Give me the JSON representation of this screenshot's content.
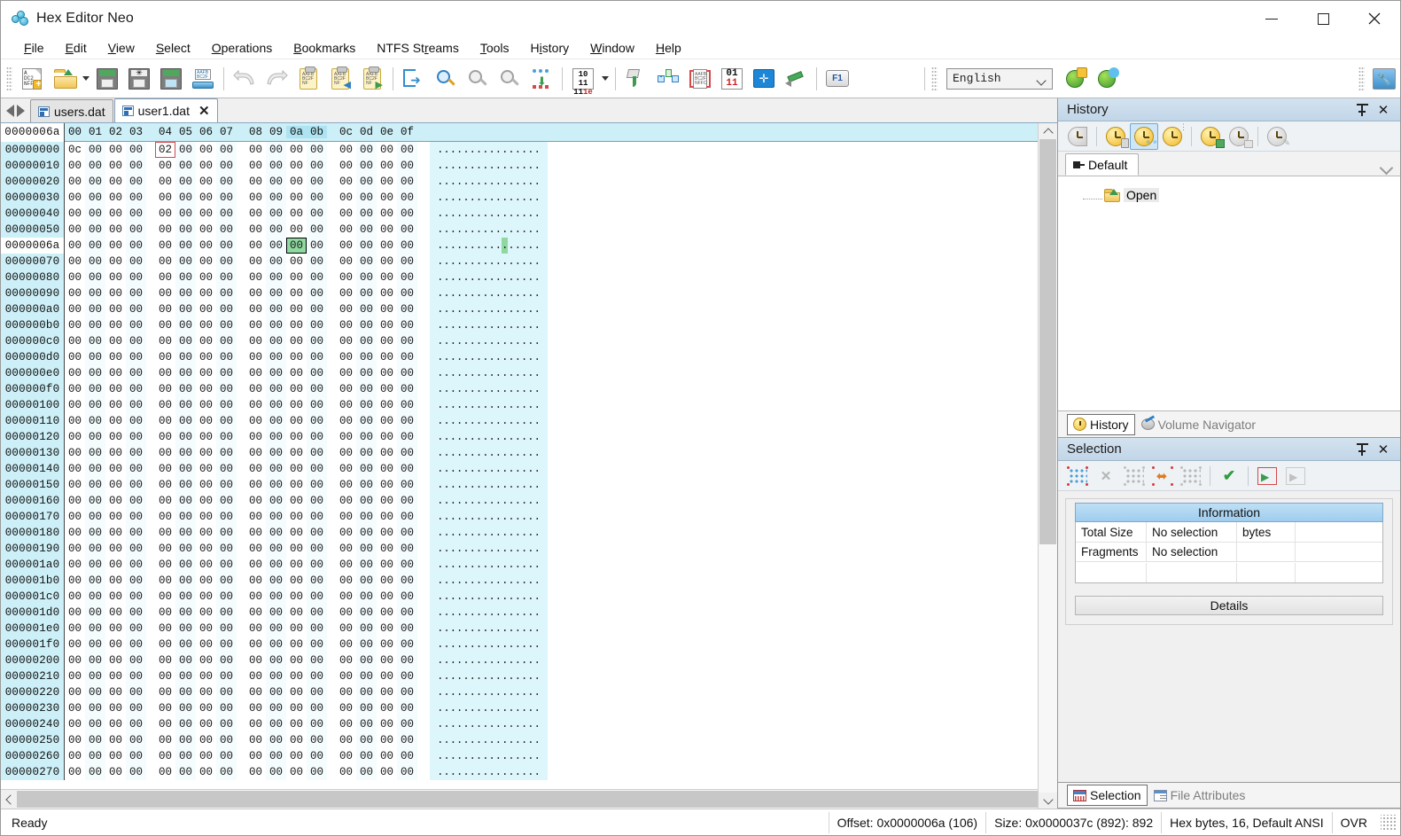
{
  "window": {
    "title": "Hex Editor Neo",
    "app_icon": "hexeditor-logo-icon",
    "minimize": "–",
    "maximize": "□",
    "close": "✕"
  },
  "menubar": {
    "items": [
      {
        "label": "File",
        "accel": "F"
      },
      {
        "label": "Edit",
        "accel": "E"
      },
      {
        "label": "View",
        "accel": "V"
      },
      {
        "label": "Select",
        "accel": "S"
      },
      {
        "label": "Operations",
        "accel": "O"
      },
      {
        "label": "Bookmarks",
        "accel": "B"
      },
      {
        "label": "NTFS Streams",
        "accel": "r"
      },
      {
        "label": "Tools",
        "accel": "T"
      },
      {
        "label": "History",
        "accel": "i"
      },
      {
        "label": "Window",
        "accel": "W"
      },
      {
        "label": "Help",
        "accel": "H"
      }
    ]
  },
  "toolbar": {
    "buttons": [
      {
        "name": "new-file-icon",
        "tip": "New"
      },
      {
        "name": "open-file-icon",
        "tip": "Open"
      },
      {
        "name": "open-dropdown-caret",
        "tip": "Open recent"
      },
      {
        "name": "save-icon",
        "tip": "Save"
      },
      {
        "name": "save-as-icon",
        "tip": "Save As"
      },
      {
        "name": "save-all-icon",
        "tip": "Save All"
      },
      {
        "name": "print-icon",
        "tip": "Print"
      },
      {
        "name": "undo-icon",
        "tip": "Undo"
      },
      {
        "name": "redo-icon",
        "tip": "Redo"
      },
      {
        "name": "edit-clipboard-icon",
        "tip": "Edit"
      },
      {
        "name": "copy-icon",
        "tip": "Copy"
      },
      {
        "name": "paste-icon",
        "tip": "Paste"
      },
      {
        "name": "export-icon",
        "tip": "Export"
      },
      {
        "name": "find-icon",
        "tip": "Find"
      },
      {
        "name": "find-prev-icon",
        "tip": "Find Previous"
      },
      {
        "name": "find-next-icon",
        "tip": "Find Next"
      },
      {
        "name": "fill-icon",
        "tip": "Fill"
      },
      {
        "name": "base-converter-icon",
        "tip": "Base Converter"
      },
      {
        "name": "base-converter-caret",
        "tip": "Base Converter options"
      },
      {
        "name": "pattern-fill-icon",
        "tip": "Pattern"
      },
      {
        "name": "bookmark-icon",
        "tip": "Bookmark"
      },
      {
        "name": "select-block-icon",
        "tip": "Select Block"
      },
      {
        "name": "binary-mode-icon",
        "tip": "Binary Mode"
      },
      {
        "name": "fullscreen-icon",
        "tip": "Full Screen"
      },
      {
        "name": "edit-pencil-icon",
        "tip": "Edit Mode"
      },
      {
        "name": "help-f1-icon",
        "tip": "Help"
      }
    ],
    "language": {
      "label": "English",
      "options": [
        "English"
      ]
    },
    "globe_add_icon": "add-language-icon",
    "globe_web_icon": "download-language-icon",
    "right_icon": "image-tools-icon"
  },
  "doc_tabs": {
    "nav_prev_icon": "nav-prev-icon",
    "nav_next_icon": "nav-next-icon",
    "tabs": [
      {
        "label": "users.dat",
        "active": false,
        "closable": false
      },
      {
        "label": "user1.dat",
        "active": true,
        "closable": true
      }
    ],
    "close_glyph": "✕"
  },
  "hex_view": {
    "offset_header": "0000006a",
    "column_headers": [
      "00",
      "01",
      "02",
      "03",
      "04",
      "05",
      "06",
      "07",
      "08",
      "09",
      "0a",
      "0b",
      "0c",
      "0d",
      "0e",
      "0f"
    ],
    "shaded_header_columns": [
      "0a",
      "0b"
    ],
    "bytes_per_row": 16,
    "row_offsets": [
      "00000000",
      "00000010",
      "00000020",
      "00000030",
      "00000040",
      "00000050",
      "0000006a",
      "00000070",
      "00000080",
      "00000090",
      "000000a0",
      "000000b0",
      "000000c0",
      "000000d0",
      "000000e0",
      "000000f0",
      "00000100",
      "00000110",
      "00000120",
      "00000130",
      "00000140",
      "00000150",
      "00000160",
      "00000170",
      "00000180",
      "00000190",
      "000001a0",
      "000001b0",
      "000001c0",
      "000001d0",
      "000001e0",
      "000001f0",
      "00000200",
      "00000210",
      "00000220",
      "00000230",
      "00000240",
      "00000250",
      "00000260",
      "00000270"
    ],
    "cursor_row_offset": "0000006a",
    "first_row_bytes": [
      "0c",
      "00",
      "00",
      "00",
      "02",
      "00",
      "00",
      "00",
      "00",
      "00",
      "00",
      "00",
      "00",
      "00",
      "00",
      "00"
    ],
    "default_byte": "00",
    "ascii_placeholder_char": ".",
    "red_box": {
      "row": 0,
      "column": 4,
      "value": "02",
      "color": "#d24a4a"
    },
    "green_selection": {
      "row": 6,
      "column": 10,
      "value": "00",
      "color": "#8fd9a0"
    }
  },
  "history_panel": {
    "title": "History",
    "pin_icon": "pin-icon",
    "close_icon": "close-icon",
    "toolbar_buttons": [
      {
        "name": "history-dock-icon",
        "pressed": false,
        "enabled": false
      },
      {
        "name": "history-clear-icon",
        "pressed": false,
        "enabled": true
      },
      {
        "name": "history-branch-icon",
        "pressed": true,
        "enabled": true
      },
      {
        "name": "history-tree-icon",
        "pressed": false,
        "enabled": true
      },
      {
        "name": "history-save-icon",
        "pressed": false,
        "enabled": true
      },
      {
        "name": "history-load-icon",
        "pressed": false,
        "enabled": false
      },
      {
        "name": "history-edit-icon",
        "pressed": false,
        "enabled": false
      }
    ],
    "branch_tab": "Default",
    "branch_tab_icon": "tack-icon",
    "dropdown_icon": "chevron-down-icon",
    "entries": [
      {
        "label": "Open",
        "icon": "open-folder-icon"
      }
    ]
  },
  "dock_tabs_top": [
    {
      "label": "History",
      "icon": "clock-icon",
      "active": true
    },
    {
      "label": "Volume Navigator",
      "icon": "volume-icon",
      "active": false
    }
  ],
  "selection_panel": {
    "title": "Selection",
    "pin_icon": "pin-icon",
    "close_icon": "close-icon",
    "toolbar_buttons": [
      {
        "name": "select-all-icon",
        "enabled": true
      },
      {
        "name": "deselect-icon",
        "enabled": false
      },
      {
        "name": "select-range-icon",
        "enabled": false
      },
      {
        "name": "select-expand-icon",
        "enabled": true
      },
      {
        "name": "select-pattern-icon",
        "enabled": false
      },
      {
        "name": "confirm-selection-icon",
        "enabled": true
      },
      {
        "name": "save-selection-icon",
        "enabled": true
      },
      {
        "name": "load-selection-icon",
        "enabled": false
      }
    ],
    "information_header": "Information",
    "rows": [
      {
        "label": "Total Size",
        "value": "No selection",
        "unit": "bytes"
      },
      {
        "label": "Fragments",
        "value": "No selection",
        "unit": ""
      }
    ],
    "details_button": "Details"
  },
  "dock_tabs_bottom": [
    {
      "label": "Selection",
      "icon": "selection-icon",
      "active": true
    },
    {
      "label": "File Attributes",
      "icon": "file-attributes-icon",
      "active": false
    }
  ],
  "statusbar": {
    "ready": "Ready",
    "offset": "Offset: 0x0000006a (106)",
    "size": "Size: 0x0000037c (892): 892",
    "mode": "Hex bytes, 16, Default ANSI",
    "insert_mode": "OVR"
  },
  "colors": {
    "offset_col_bg": "#cdeff7",
    "ascii_col_bg": "#ddf6fb",
    "header_bg": "#cdeff7",
    "header_shaded": "#aee4f2",
    "selection_green": "#8fd9a0",
    "cursor_red": "#d24a4a",
    "caption_blue": "#c2d6e8",
    "info_header": "#9fcdef"
  }
}
